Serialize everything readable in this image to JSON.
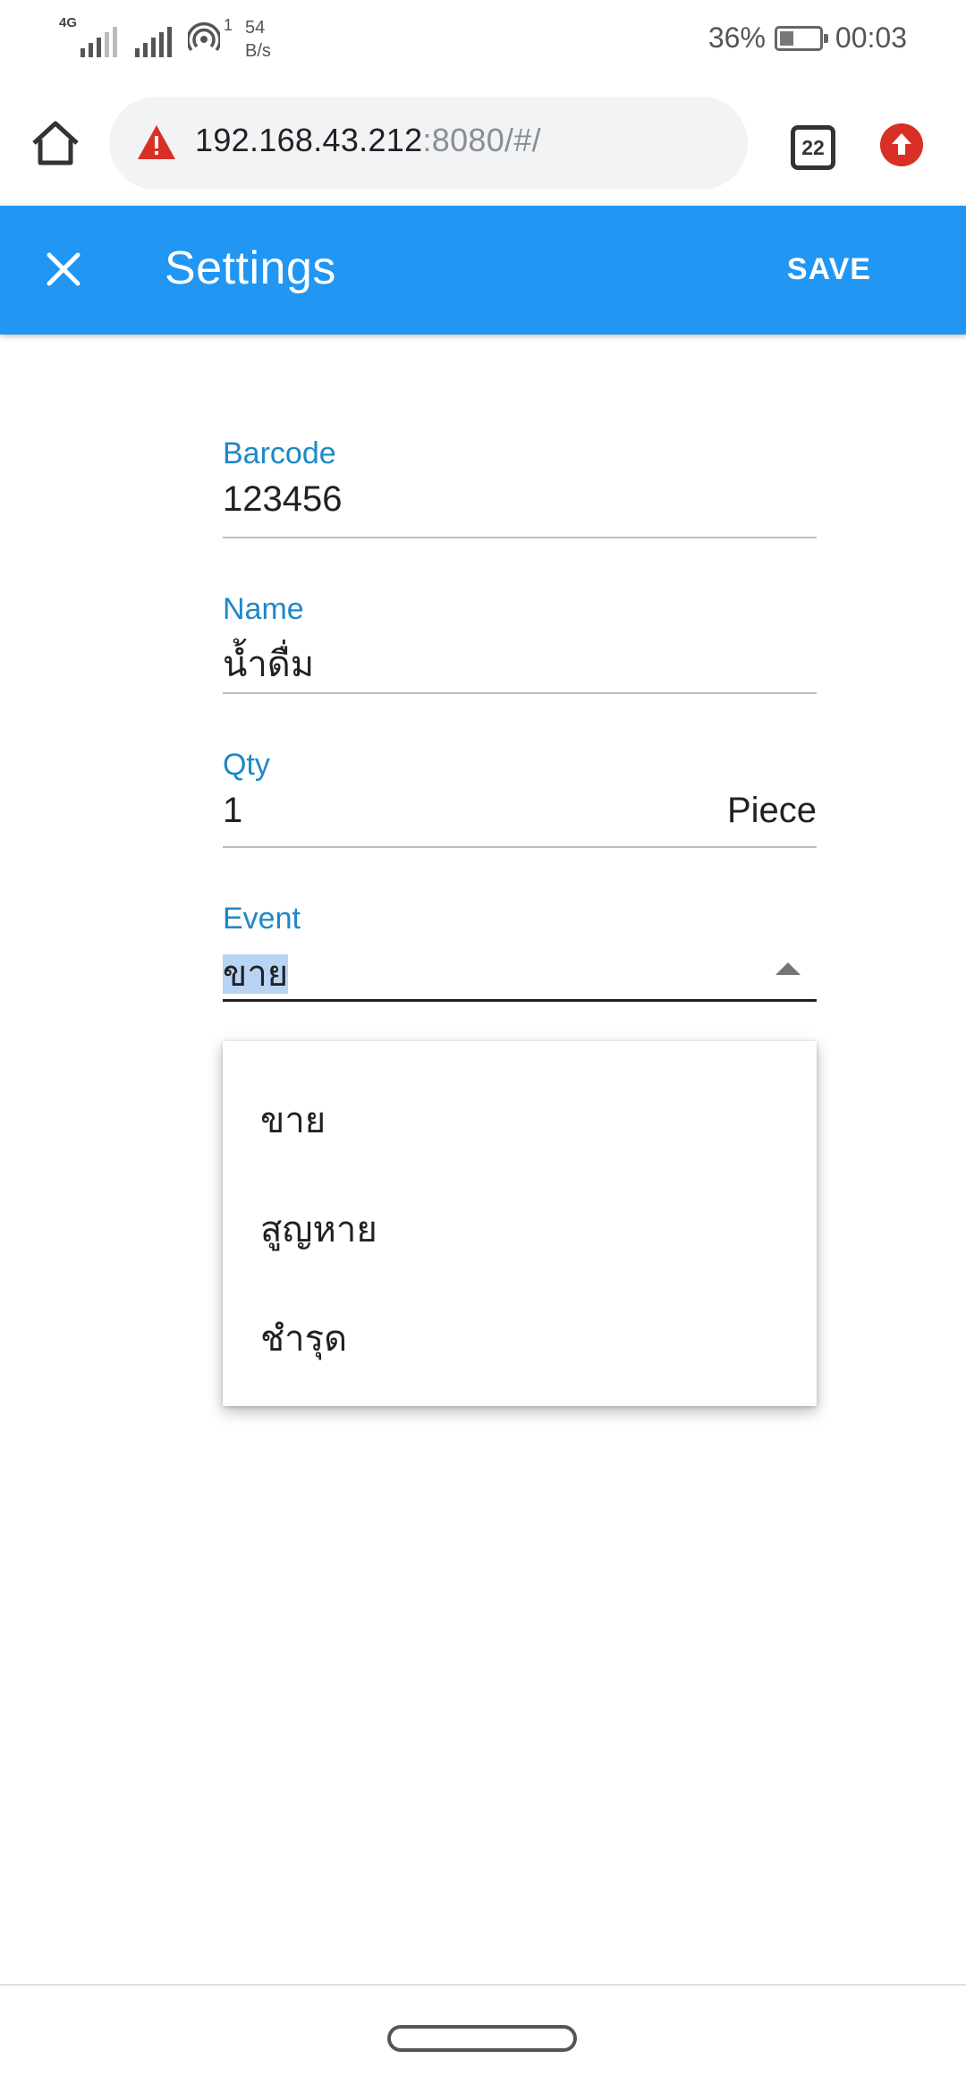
{
  "status_bar": {
    "network_type": "4G",
    "speed_value": "54",
    "speed_unit": "B/s",
    "hotspot_count": "1",
    "battery": "36%",
    "battery_level": 0.36,
    "time": "00:03"
  },
  "browser": {
    "url_host": "192.168.43.212",
    "url_rest": ":8080/#/",
    "tab_count": "22",
    "home_icon": "home-icon",
    "security_icon": "warning-triangle-icon",
    "update_icon": "upload-arrow-icon"
  },
  "app_bar": {
    "title": "Settings",
    "save_label": "SAVE",
    "close_icon": "close-icon",
    "color": "#2196f3"
  },
  "form": {
    "barcode": {
      "label": "Barcode",
      "value": "123456"
    },
    "name": {
      "label": "Name",
      "value": "น้ำดื่ม"
    },
    "qty": {
      "label": "Qty",
      "value": "1",
      "unit": "Piece"
    },
    "event": {
      "label": "Event",
      "value": "ขาย"
    }
  },
  "dropdown": {
    "options": [
      "ขาย",
      "สูญหาย",
      "ชำรุด"
    ]
  }
}
